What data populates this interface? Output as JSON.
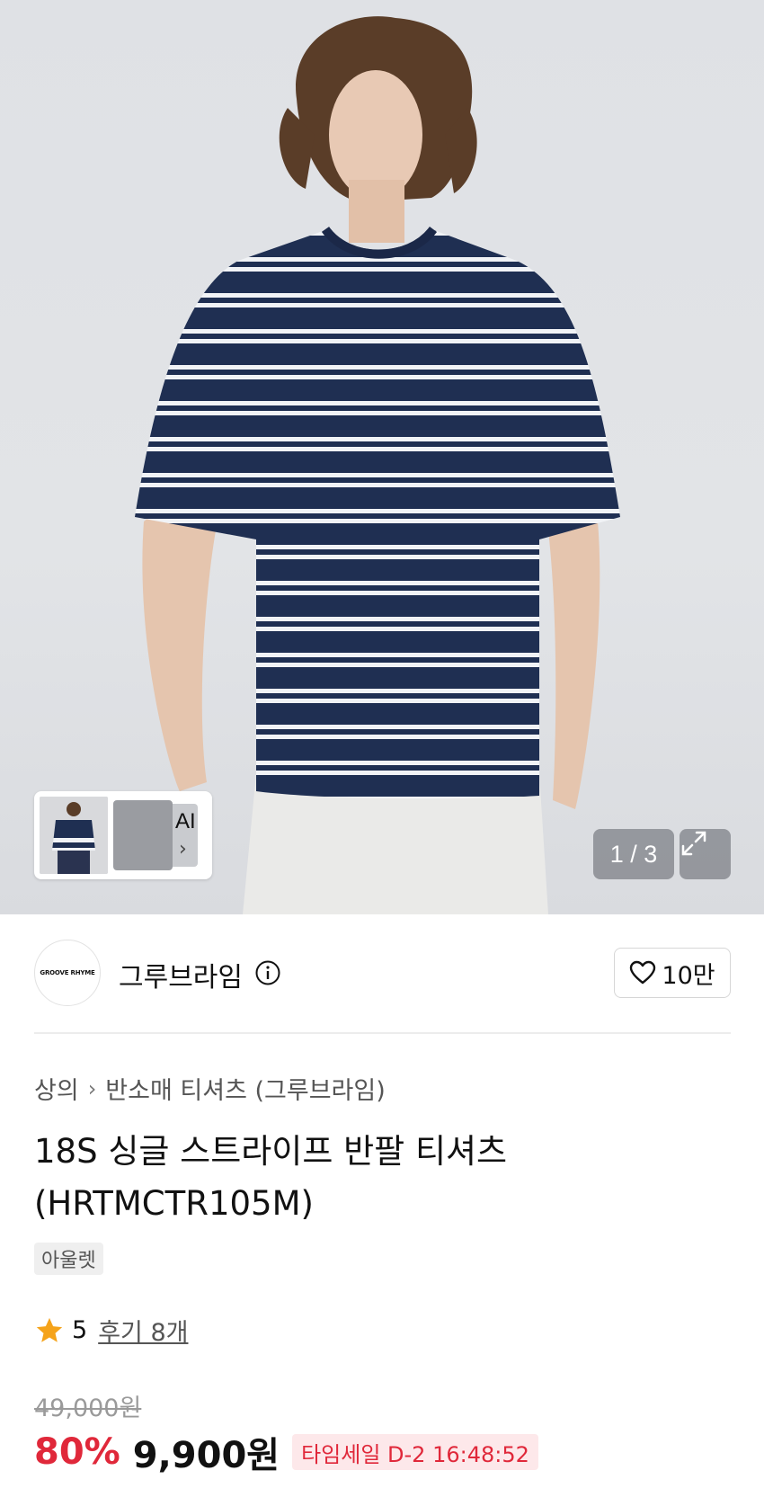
{
  "gallery": {
    "ai_label": "AI",
    "counter": "1 / 3"
  },
  "brand": {
    "logo_text": "GROOVE RHYME",
    "name": "그루브라임",
    "like_count": "10만"
  },
  "breadcrumb": {
    "category": "상의",
    "subcategory": "반소매 티셔츠 (그루브라임)"
  },
  "product": {
    "title": "18S 싱글 스트라이프 반팔 티셔츠 (HRTMCTR105M)",
    "badge": "아울렛",
    "rating": "5",
    "review_link": "후기 8개"
  },
  "price": {
    "original": "49,000원",
    "discount": "80%",
    "sale": "9,900원",
    "timesale": "타임세일 D-2 16:48:52"
  },
  "colors": {
    "discount_red": "#e0283a",
    "star": "#f5a31a",
    "shirt_navy": "#1f2f52"
  }
}
